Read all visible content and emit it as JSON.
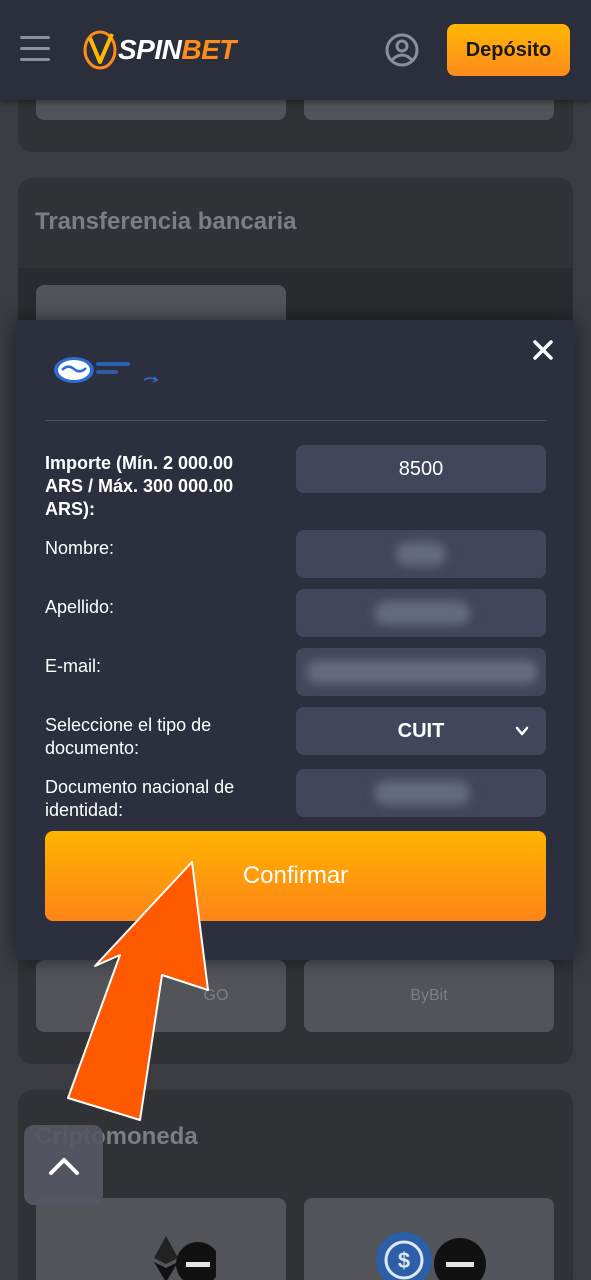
{
  "header": {
    "logo_prefix": "SPIN",
    "logo_suffix": "BET",
    "deposit_label": "Depósito",
    "colors": {
      "background": "#2b2f3b",
      "accent": "#ff8c1a"
    }
  },
  "page": {
    "bank_transfer_title": "Transferencia bancaria",
    "crypto_title": "Criptomoneda",
    "tiles": [
      "GO",
      "ByBit"
    ]
  },
  "modal": {
    "brand_icon": "mercado-pago-logo",
    "close_icon": "close-icon",
    "fields": {
      "amount_label": "Importe (Mín. 2 000.00 ARS / Máx. 300 000.00 ARS):",
      "amount_value": "8500",
      "first_name_label": "Nombre:",
      "last_name_label": "Apellido:",
      "email_label": "E-mail:",
      "doc_type_label": "Seleccione el tipo de documento:",
      "doc_type_value": "CUIT",
      "doc_number_label": "Documento nacional de identidad:"
    },
    "confirm_label": "Confirmar"
  },
  "scroll_top_icon": "chevron-up-icon",
  "annotation_arrow_color": "#ff5a00"
}
